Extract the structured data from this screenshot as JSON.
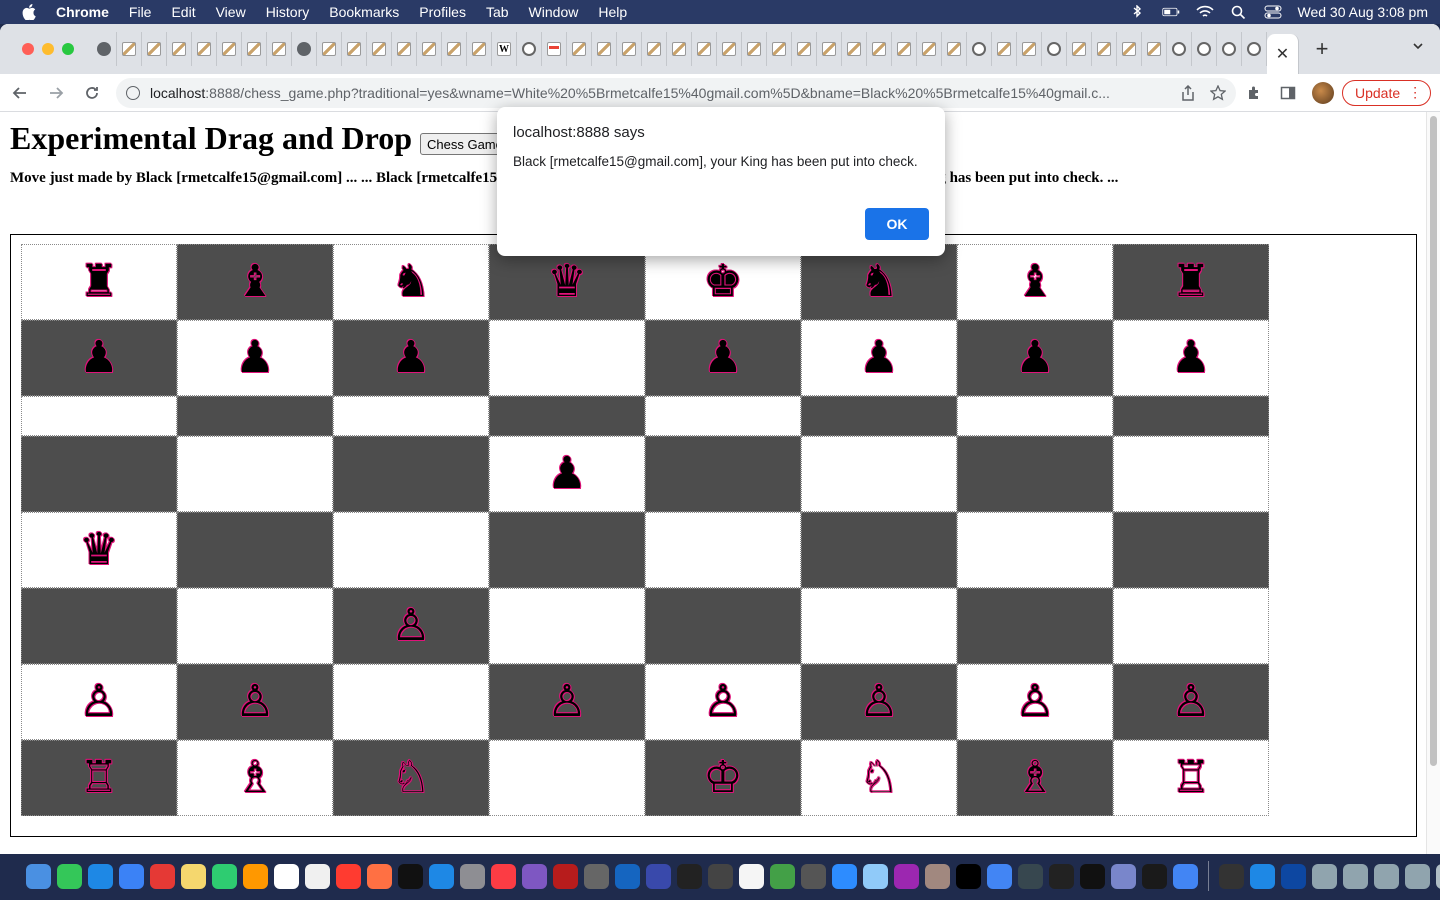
{
  "menubar": {
    "app": "Chrome",
    "items": [
      "File",
      "Edit",
      "View",
      "History",
      "Bookmarks",
      "Profiles",
      "Tab",
      "Window",
      "Help"
    ],
    "clock": "Wed 30 Aug  3:08 pm"
  },
  "browser": {
    "url_host": "localhost",
    "url_rest": ":8888/chess_game.php?traditional=yes&wname=White%20%5Brmetcalfe15%40gmail.com%5D&bname=Black%20%5Brmetcalfe15%40gmail.c...",
    "update_label": "Update",
    "tab_favicons": [
      "chrome",
      "generic",
      "generic",
      "generic",
      "generic",
      "generic",
      "generic",
      "generic",
      "globe",
      "generic",
      "generic",
      "generic",
      "generic",
      "generic",
      "generic",
      "generic",
      "wiki",
      "circle",
      "mail",
      "generic",
      "generic",
      "generic",
      "generic",
      "generic",
      "generic",
      "generic",
      "generic",
      "generic",
      "generic",
      "generic",
      "generic",
      "generic",
      "generic",
      "generic",
      "generic",
      "circle",
      "generic",
      "generic",
      "circle",
      "generic",
      "generic",
      "generic",
      "generic",
      "circle",
      "circle",
      "circle",
      "circle"
    ]
  },
  "page": {
    "title": "Experimental Drag and Drop",
    "game_button": "Chess Game",
    "status_left": "Move just made by Black [rmetcalfe15@gmail.com] ... ... Black [rmetcalfe15@gm",
    "status_right": "ng has been put into check. ..."
  },
  "board": {
    "rows": [
      [
        "♜",
        "♝",
        "♞",
        "♛",
        "♚",
        "♞",
        "♝",
        "♜"
      ],
      [
        "♟",
        "♟",
        "♟",
        "",
        "♟",
        "♟",
        "♟",
        "♟"
      ],
      [
        "",
        "",
        "",
        "",
        "",
        "",
        "",
        ""
      ],
      [
        "",
        "",
        "",
        "♟",
        "",
        "",
        "",
        ""
      ],
      [
        "♛",
        "",
        "",
        "",
        "",
        "",
        "",
        ""
      ],
      [
        "",
        "",
        "♙",
        "",
        "",
        "",
        "",
        ""
      ],
      [
        "♙",
        "♙",
        "",
        "♙",
        "♙",
        "♙",
        "♙",
        "♙"
      ],
      [
        "♖",
        "♗",
        "♘",
        "",
        "♔",
        "♘",
        "♗",
        "♖"
      ]
    ],
    "piece_outline_color": "#e0137a",
    "dark_square_color": "#4d4d4d"
  },
  "dialog": {
    "title": "localhost:8888 says",
    "message": "Black [rmetcalfe15@gmail.com], your King has been put into check.",
    "ok_label": "OK"
  },
  "dock": {
    "icons": [
      "finder",
      "messages",
      "safari",
      "mail",
      "opera",
      "notes",
      "facetime",
      "photos",
      "calendar",
      "reminders",
      "news",
      "firefox",
      "tv",
      "app-store",
      "settings",
      "music",
      "launchpad",
      "filezilla",
      "calculator",
      "xcode",
      "bbedit",
      "activity",
      "sequel",
      "textedit",
      "maps",
      "unity",
      "zoom",
      "preview",
      "podcasts",
      "postgres",
      "intellij",
      "chrome",
      "quicktime",
      "unity2",
      "terminal",
      "migration",
      "tv2",
      "chrome2",
      "console",
      "folder",
      "globe",
      "window1",
      "window2",
      "window3",
      "window4",
      "trash"
    ]
  }
}
